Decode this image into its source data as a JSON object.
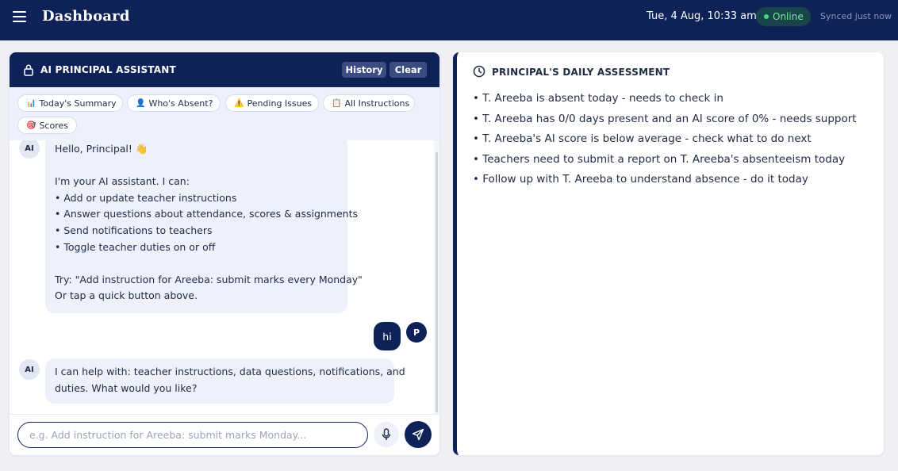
{
  "header": {
    "title": "Dashboard",
    "datetime": "Tue, 4 Aug, 10:33 am",
    "status": "Online",
    "sync_status": "Synced just now"
  },
  "chat": {
    "title": "AI PRINCIPAL ASSISTANT",
    "history_label": "History",
    "clear_label": "Clear",
    "quick_actions": [
      {
        "icon": "📊",
        "label": "Today's Summary"
      },
      {
        "icon": "👤",
        "label": "Who's Absent?"
      },
      {
        "icon": "⚠️",
        "label": "Pending Issues"
      },
      {
        "icon": "📋",
        "label": "All Instructions"
      },
      {
        "icon": "🎯",
        "label": "Scores"
      }
    ],
    "messages": [
      {
        "sender": "AI",
        "lines": [
          "Hello, Principal! 👋",
          "",
          "I'm your AI assistant. I can:",
          "• Add or update teacher instructions",
          "• Answer questions about attendance, scores & assignments",
          "• Send notifications to teachers",
          "• Toggle teacher duties on or off",
          "",
          "Try: \"Add instruction for Areeba: submit marks every Monday\"",
          "Or tap a quick button above."
        ]
      },
      {
        "sender": "P",
        "text": "hi"
      },
      {
        "sender": "AI",
        "lines": [
          "I can help with: teacher instructions, data questions, notifications, and",
          "duties. What would you like?"
        ]
      }
    ],
    "input_placeholder": "e.g. Add instruction for Areeba: submit marks Monday..."
  },
  "assessment": {
    "title": "PRINCIPAL'S DAILY ASSESSMENT",
    "items": [
      "• T. Areeba is absent today - needs to check in",
      "• T. Areeba has 0/0 days present and an AI score of 0% - needs support",
      "• T. Areeba's AI score is below average - check what to do next",
      "• Teachers need to submit a report on T. Areeba's absenteeism today",
      "• Follow up with T. Areeba to understand absence - do it today"
    ]
  },
  "colors": {
    "navy": "#0f2258",
    "online_green": "#3ddc84",
    "bubble_bg": "#eef1fb"
  }
}
